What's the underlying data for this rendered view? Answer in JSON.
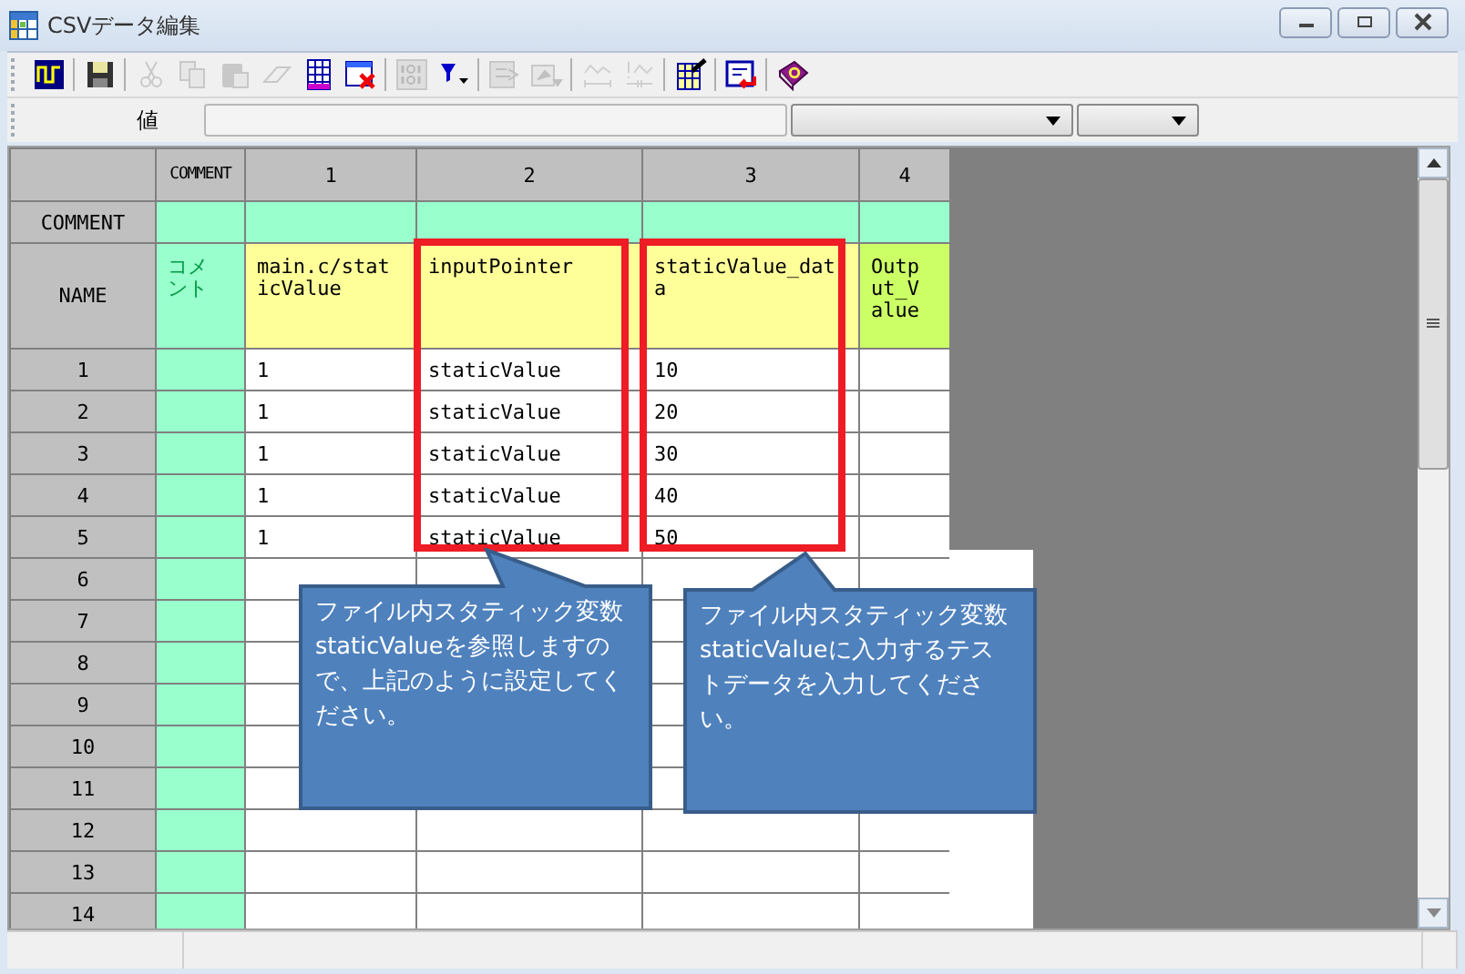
{
  "window": {
    "title": "CSVデータ編集"
  },
  "toolbar": [
    {
      "kind": "wave",
      "disabled": false
    },
    {
      "kind": "separator"
    },
    {
      "kind": "save",
      "disabled": false
    },
    {
      "kind": "separator"
    },
    {
      "kind": "cut",
      "disabled": true
    },
    {
      "kind": "copy",
      "disabled": true
    },
    {
      "kind": "paste",
      "disabled": true
    },
    {
      "kind": "eraser",
      "disabled": true
    },
    {
      "kind": "grid",
      "disabled": false
    },
    {
      "kind": "grid-delete",
      "disabled": false
    },
    {
      "kind": "separator"
    },
    {
      "kind": "binary",
      "disabled": true
    },
    {
      "kind": "filter",
      "disabled": false
    },
    {
      "kind": "separator"
    },
    {
      "kind": "export",
      "disabled": true
    },
    {
      "kind": "import",
      "disabled": true
    },
    {
      "kind": "separator"
    },
    {
      "kind": "wave-expand",
      "disabled": true
    },
    {
      "kind": "wave-shrink",
      "disabled": true
    },
    {
      "kind": "separator"
    },
    {
      "kind": "table-edit",
      "disabled": false
    },
    {
      "kind": "separator"
    },
    {
      "kind": "return",
      "disabled": false
    },
    {
      "kind": "separator"
    },
    {
      "kind": "book",
      "disabled": false
    }
  ],
  "value_bar": {
    "label": "値"
  },
  "grid": {
    "comment_row_label": "COMMENT",
    "name_row_label": "NAME",
    "columns": [
      {
        "label": "COMMENT",
        "kind": "comment",
        "name": "コメント",
        "highlighted": false
      },
      {
        "label": "1",
        "kind": "input",
        "name": "main.c/staticValue",
        "highlighted": false
      },
      {
        "label": "2",
        "kind": "input",
        "name": "inputPointer",
        "highlighted": true
      },
      {
        "label": "3",
        "kind": "input",
        "name": "staticValue_data",
        "highlighted": true
      },
      {
        "label": "4",
        "kind": "output",
        "name": "Output_Value",
        "highlighted": false
      }
    ],
    "rows": [
      {
        "header": "1",
        "values": [
          "1",
          "staticValue",
          "10"
        ]
      },
      {
        "header": "2",
        "values": [
          "1",
          "staticValue",
          "20"
        ]
      },
      {
        "header": "3",
        "values": [
          "1",
          "staticValue",
          "30"
        ]
      },
      {
        "header": "4",
        "values": [
          "1",
          "staticValue",
          "40"
        ]
      },
      {
        "header": "5",
        "values": [
          "1",
          "staticValue",
          "50"
        ]
      },
      {
        "header": "6"
      },
      {
        "header": "7"
      },
      {
        "header": "8"
      },
      {
        "header": "9"
      },
      {
        "header": "10"
      },
      {
        "header": "11"
      },
      {
        "header": "12"
      },
      {
        "header": "13"
      },
      {
        "header": "14"
      }
    ]
  },
  "callouts": [
    {
      "text": "ファイル内スタティック変数staticValueを参照しますので、上記のように設定してください。"
    },
    {
      "text": "ファイル内スタティック変数staticValueに入力するテストデータを入力してください。"
    }
  ]
}
